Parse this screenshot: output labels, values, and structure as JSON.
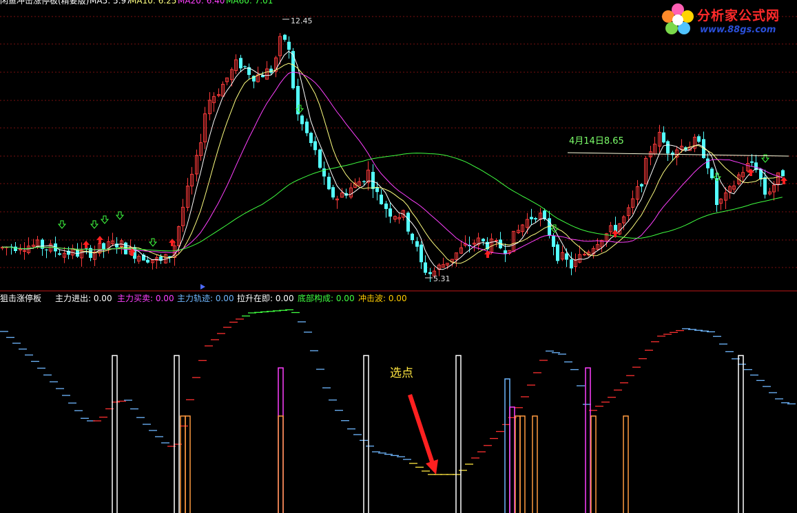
{
  "top_title": "闲鱼冲击涨停板(精要版)",
  "ma_legend": [
    {
      "label": "MA5: 5.97",
      "color": "#ffffff"
    },
    {
      "label": "MA10: 6.25",
      "color": "#ffff80"
    },
    {
      "label": "MA20: 6.40",
      "color": "#ff40ff"
    },
    {
      "label": "MA60: 7.01",
      "color": "#40ff40"
    }
  ],
  "logo": {
    "title": "分析家公式网",
    "url": "www.88gs.com"
  },
  "price_labels": {
    "high": "12.45",
    "low": "5.31",
    "annotation": "4月14日8.65"
  },
  "indicator": {
    "name": "狙击涨停板",
    "items": [
      {
        "label": "主力进出: 0.00",
        "color": "#ffffff"
      },
      {
        "label": "主力买卖: 0.00",
        "color": "#ff40ff"
      },
      {
        "label": "主力轨迹: 0.00",
        "color": "#6fb7ff"
      },
      {
        "label": "拉升在即: 0.00",
        "color": "#ffffff"
      },
      {
        "label": "底部构成: 0.00",
        "color": "#40ff40"
      },
      {
        "label": "冲击波: 0.00",
        "color": "#ffcc00"
      }
    ],
    "callout": "选点"
  },
  "colors": {
    "up": "#ff3b3b",
    "down": "#54ffff",
    "grid": "#7a1010",
    "separator": "#c01818"
  }
}
